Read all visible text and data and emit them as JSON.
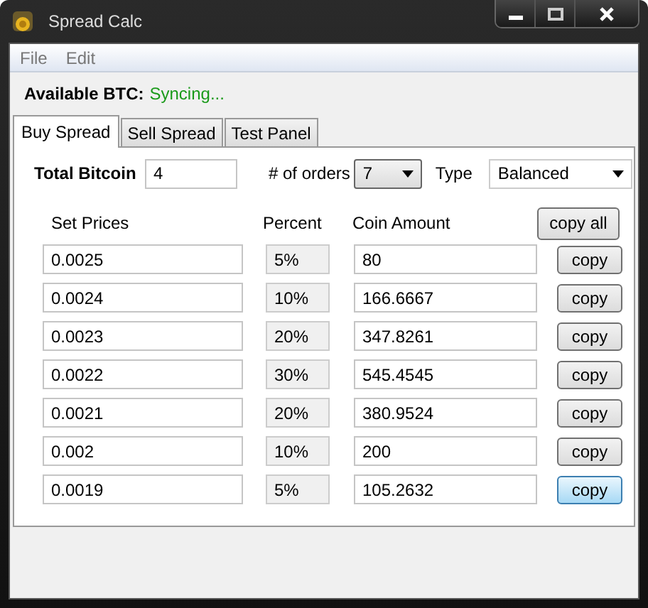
{
  "window": {
    "title": "Spread Calc"
  },
  "menu": [
    "File",
    "Edit"
  ],
  "available": {
    "label": "Available BTC:",
    "value": "Syncing..."
  },
  "tabs": [
    {
      "label": "Buy Spread",
      "selected": true
    },
    {
      "label": "Sell Spread",
      "selected": false
    },
    {
      "label": "Test Panel",
      "selected": false
    }
  ],
  "total_bitcoin": {
    "label": "Total Bitcoin",
    "value": "4"
  },
  "orders": {
    "label": "# of orders",
    "value": "7"
  },
  "type": {
    "label": "Type",
    "value": "Balanced"
  },
  "columns": [
    "Set Prices",
    "Percent",
    "Coin Amount"
  ],
  "copy_all": "copy all",
  "rows": [
    {
      "price": "0.0025",
      "percent": "5%",
      "amount": "80",
      "button": "copy",
      "highlighted": false
    },
    {
      "price": "0.0024",
      "percent": "10%",
      "amount": "166.6667",
      "button": "copy",
      "highlighted": false
    },
    {
      "price": "0.0023",
      "percent": "20%",
      "amount": "347.8261",
      "button": "copy",
      "highlighted": false
    },
    {
      "price": "0.0022",
      "percent": "30%",
      "amount": "545.4545",
      "button": "copy",
      "highlighted": false
    },
    {
      "price": "0.0021",
      "percent": "20%",
      "amount": "380.9524",
      "button": "copy",
      "highlighted": false
    },
    {
      "price": "0.002",
      "percent": "10%",
      "amount": "200",
      "button": "copy",
      "highlighted": false
    },
    {
      "price": "0.0019",
      "percent": "5%",
      "amount": "105.2632",
      "button": "copy",
      "highlighted": true
    }
  ]
}
